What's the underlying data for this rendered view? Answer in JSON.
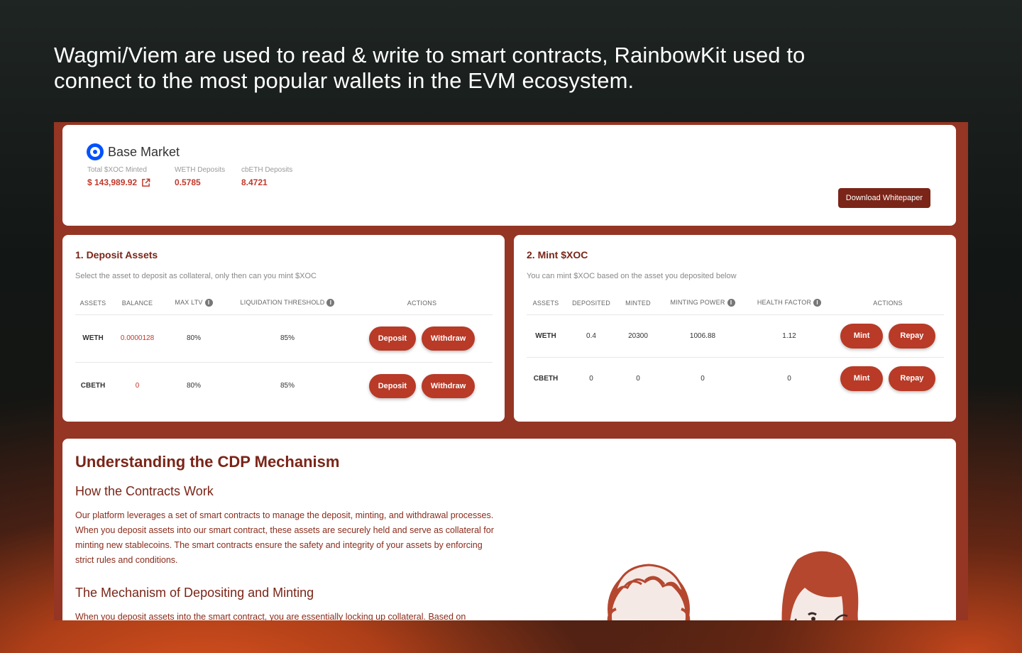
{
  "headline": "Wagmi/Viem are used to read & write to smart contracts, RainbowKit used to connect to the most popular wallets in the EVM ecosystem.",
  "market": {
    "name": "Base Market",
    "stats": [
      {
        "label": "Total $XOC Minted",
        "value": "$ 143,989.92"
      },
      {
        "label": "WETH Deposits",
        "value": "0.5785"
      },
      {
        "label": "cbETH Deposits",
        "value": "8.4721"
      }
    ],
    "whitepaper_label": "Download Whitepaper"
  },
  "deposit": {
    "title": "1. Deposit Assets",
    "description": "Select the asset to deposit as collateral, only then can you mint $XOC",
    "headers": {
      "assets": "Assets",
      "balance": "Balance",
      "max_ltv": "Max LTV",
      "liq": "Liquidation Threshold",
      "actions": "Actions"
    },
    "rows": [
      {
        "asset": "WETH",
        "balance": "0.0000128",
        "max_ltv": "80%",
        "liq": "85%",
        "deposit": "Deposit",
        "withdraw": "Withdraw"
      },
      {
        "asset": "CBETH",
        "balance": "0",
        "max_ltv": "80%",
        "liq": "85%",
        "deposit": "Deposit",
        "withdraw": "Withdraw"
      }
    ]
  },
  "mint": {
    "title": "2. Mint $XOC",
    "description": "You can mint $XOC based on the asset you deposited below",
    "headers": {
      "assets": "Assets",
      "deposited": "Deposited",
      "minted": "Minted",
      "power": "Minting Power",
      "health": "Health Factor",
      "actions": "Actions"
    },
    "rows": [
      {
        "asset": "WETH",
        "deposited": "0.4",
        "minted": "20300",
        "power": "1006.88",
        "health": "1.12",
        "mint": "Mint",
        "repay": "Repay"
      },
      {
        "asset": "CBETH",
        "deposited": "0",
        "minted": "0",
        "power": "0",
        "health": "0",
        "mint": "Mint",
        "repay": "Repay"
      }
    ]
  },
  "info": {
    "title": "Understanding the CDP Mechanism",
    "subtitle1": "How the Contracts Work",
    "para1": "Our platform leverages a set of smart contracts to manage the deposit, minting, and withdrawal processes. When you deposit assets into our smart contract, these assets are securely held and serve as collateral for minting new stablecoins. The smart contracts ensure the safety and integrity of your assets by enforcing strict rules and conditions.",
    "subtitle2": "The Mechanism of Depositing and Minting",
    "para2": "When you deposit assets into the smart contract, you are essentially locking up collateral. Based on"
  },
  "colors": {
    "brand": "#953524",
    "accent": "#b83a27",
    "dark_button": "#7a2518",
    "base_blue": "#0052ff"
  },
  "icons": {
    "info": "info-icon",
    "external": "external-link-icon",
    "logo": "base-logo-icon"
  }
}
